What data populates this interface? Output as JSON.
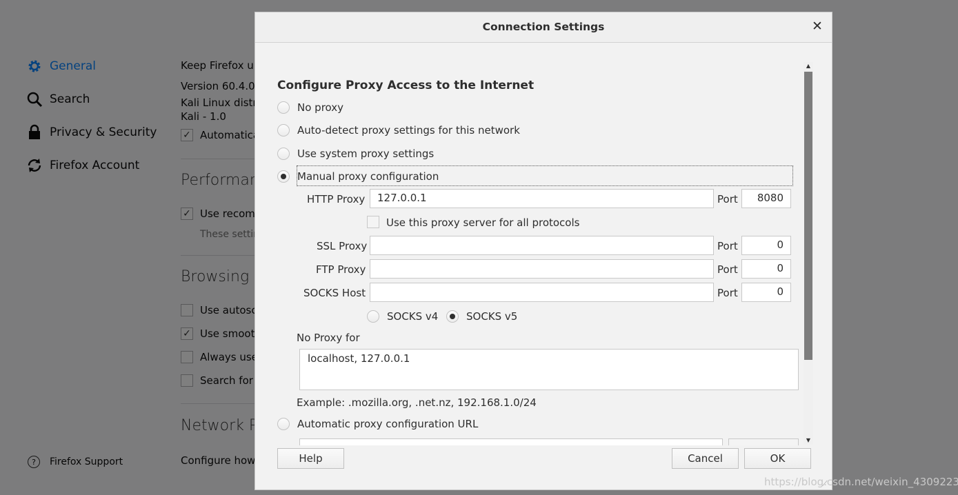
{
  "background": {
    "sidebar": {
      "items": [
        {
          "label": "General",
          "icon": "gear-icon",
          "active": true
        },
        {
          "label": "Search",
          "icon": "search-icon",
          "active": false
        },
        {
          "label": "Privacy & Security",
          "icon": "lock-icon",
          "active": false
        },
        {
          "label": "Firefox Account",
          "icon": "sync-icon",
          "active": false
        }
      ],
      "support": "Firefox Support"
    },
    "content": {
      "keep_updated": "Keep Firefox up",
      "version": "Version 60.4.0",
      "distro": "Kali Linux distr",
      "kali": "Kali - 1.0",
      "automatic": "Automatica",
      "performance": "Performan",
      "use_recommended": "Use recom",
      "these_settings": "These settin",
      "browsing": "Browsing",
      "use_autoscroll": "Use autosc",
      "use_smooth": "Use smoot",
      "always_use": "Always use",
      "search_for": "Search for",
      "network": "Network P",
      "configure_how": "Configure how"
    }
  },
  "dialog": {
    "title": "Connection Settings",
    "heading": "Configure Proxy Access to the Internet",
    "options": {
      "no_proxy": "No proxy",
      "auto_detect": "Auto-detect proxy settings for this network",
      "system": "Use system proxy settings",
      "manual": "Manual proxy configuration",
      "auto_url": "Automatic proxy configuration URL"
    },
    "http": {
      "label": "HTTP Proxy",
      "value": "127.0.0.1",
      "port_label": "Port",
      "port": "8080"
    },
    "use_all": "Use this proxy server for all protocols",
    "ssl": {
      "label": "SSL Proxy",
      "value": "",
      "port_label": "Port",
      "port": "0"
    },
    "ftp": {
      "label": "FTP Proxy",
      "value": "",
      "port_label": "Port",
      "port": "0"
    },
    "socks": {
      "label": "SOCKS Host",
      "value": "",
      "port_label": "Port",
      "port": "0"
    },
    "socks_v4": "SOCKS v4",
    "socks_v5": "SOCKS v5",
    "no_proxy_for": "No Proxy for",
    "no_proxy_value": "localhost, 127.0.0.1",
    "example": "Example: .mozilla.org, .net.nz, 192.168.1.0/24",
    "buttons": {
      "help": "Help",
      "cancel": "Cancel",
      "ok": "OK"
    }
  },
  "watermark": "https://blog.csdn.net/weixin_43092232",
  "colors": {
    "accent": "#0a84ff",
    "overlay": "rgba(0,0,0,0.5)"
  }
}
